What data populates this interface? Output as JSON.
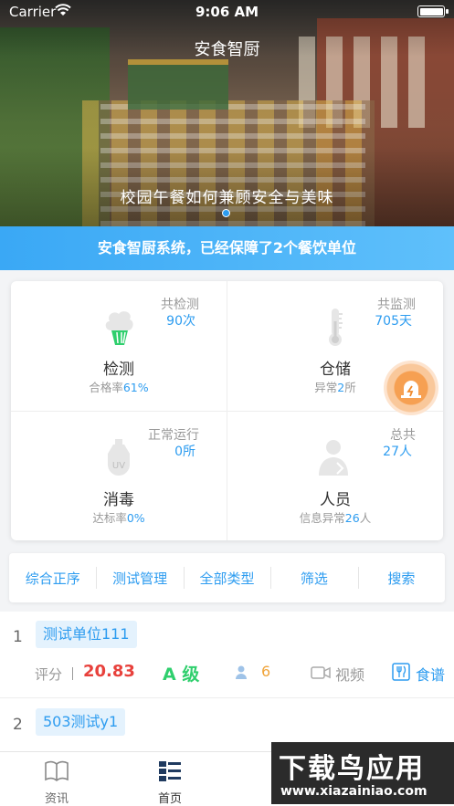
{
  "status_bar": {
    "carrier": "Carrier",
    "time": "9:06 AM"
  },
  "hero": {
    "title": "安食智厨",
    "caption": "校园午餐如何兼顾安全与美味",
    "active_slide": 1,
    "slide_count": 1
  },
  "banner": {
    "text": "安食智厨系统，已经保障了2个餐饮单位"
  },
  "stats": [
    {
      "icon": "vegetable-icon",
      "top_label": "共检测",
      "top_value": "90",
      "top_unit": "次",
      "name": "检测",
      "sub_prefix": "合格率",
      "sub_value": "61%",
      "sub_suffix": ""
    },
    {
      "icon": "thermometer-icon",
      "top_label": "共监测",
      "top_value": "705",
      "top_unit": "天",
      "name": "仓储",
      "sub_prefix": "异常",
      "sub_value": "2",
      "sub_suffix": "所"
    },
    {
      "icon": "uv-lamp-icon",
      "top_label": "正常运行",
      "top_value": "0",
      "top_unit": "所",
      "name": "消毒",
      "sub_prefix": "达标率",
      "sub_value": "0%",
      "sub_suffix": ""
    },
    {
      "icon": "chef-icon",
      "top_label": "总共",
      "top_value": "27",
      "top_unit": "人",
      "name": "人员",
      "sub_prefix": "信息异常",
      "sub_value": "26",
      "sub_suffix": "人"
    }
  ],
  "filters": [
    "综合正序",
    "测试管理",
    "全部类型",
    "筛选",
    "搜索"
  ],
  "list": [
    {
      "index": "1",
      "name": "测试单位111",
      "score_label": "评分",
      "score": "20.83",
      "grade": "A 级",
      "people": "6",
      "video_label": "视频",
      "menu_label": "食谱"
    },
    {
      "index": "2",
      "name": "503测试y1",
      "score_label": "",
      "score": "",
      "grade": "",
      "people": "",
      "video_label": "",
      "menu_label": ""
    }
  ],
  "tabs": [
    {
      "label": "资讯",
      "icon": "book-icon"
    },
    {
      "label": "首页",
      "icon": "home-list-icon",
      "active": true
    }
  ],
  "watermark": {
    "line1": "下载鸟应用",
    "line2": "www.xiazainiao.com"
  },
  "colors": {
    "accent": "#2d9cf0",
    "score": "#e8413c",
    "grade": "#2fcf6d",
    "people": "#f0a43a"
  }
}
